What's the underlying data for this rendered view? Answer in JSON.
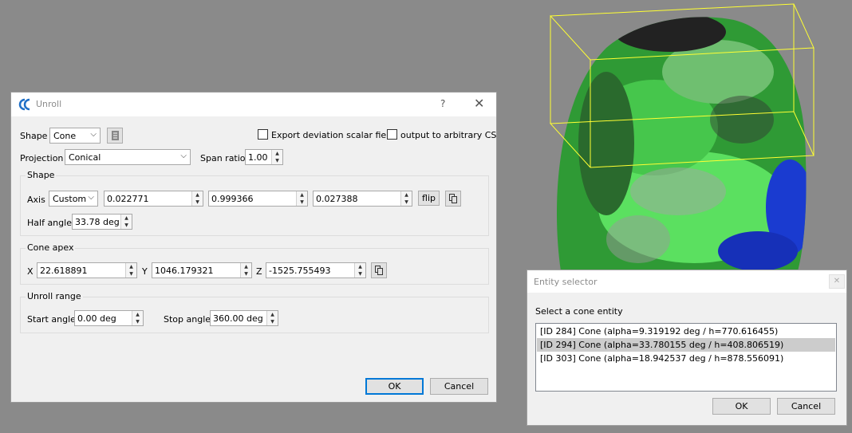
{
  "unroll_dialog": {
    "title": "Unroll",
    "help": "?",
    "close": "✕",
    "shape_label": "Shape",
    "shape_value": "Cone",
    "export_deviation_label": "Export deviation scalar field",
    "output_arbitrary_cs_label": "output to arbitrary CS",
    "projection_label": "Projection",
    "projection_value": "Conical",
    "span_ratio_label": "Span ratio",
    "span_ratio_value": "1.00",
    "shape_group": {
      "title": "Shape",
      "axis_label": "Axis",
      "axis_mode": "Custom",
      "axis_x": "0.022771",
      "axis_y": "0.999366",
      "axis_z": "0.027388",
      "flip_label": "flip",
      "half_angle_label": "Half angle",
      "half_angle_value": "33.78 deg"
    },
    "apex_group": {
      "title": "Cone apex",
      "x_label": "X",
      "x_value": "22.618891",
      "y_label": "Y",
      "y_value": "1046.179321",
      "z_label": "Z",
      "z_value": "-1525.755493"
    },
    "range_group": {
      "title": "Unroll range",
      "start_label": "Start angle",
      "start_value": "0.00 deg",
      "stop_label": "Stop angle",
      "stop_value": "360.00 deg"
    },
    "ok_label": "OK",
    "cancel_label": "Cancel"
  },
  "entity_selector": {
    "title": "Entity selector",
    "prompt": "Select a cone entity",
    "items": [
      "[ID 284] Cone (alpha=9.319192 deg / h=770.616455)",
      "[ID 294] Cone (alpha=33.780155 deg / h=408.806519)",
      "[ID 303] Cone (alpha=18.942537 deg / h=878.556091)"
    ],
    "selected_index": 1,
    "ok_label": "OK",
    "cancel_label": "Cancel"
  },
  "colors": {
    "background": "#8a8a8a",
    "bounding_box": "#ffff33",
    "mesh_green": "#3ec043",
    "mesh_blue": "#1a3bd0",
    "accent": "#0078d7"
  }
}
